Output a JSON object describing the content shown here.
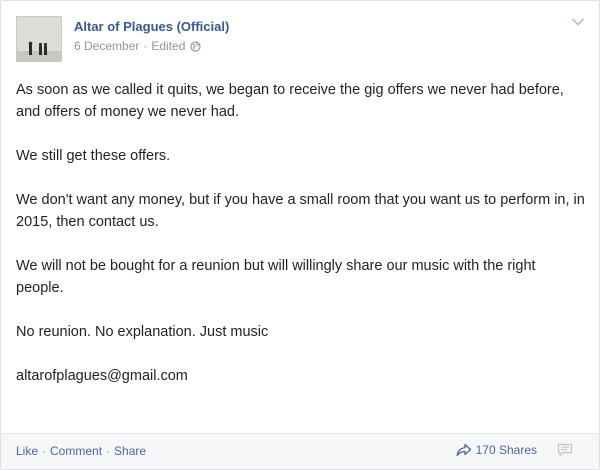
{
  "post": {
    "author": "Altar of Plagues (Official)",
    "date": "6 December",
    "edited": "Edited",
    "paragraphs": [
      "As soon as we called it quits, we began to receive the gig offers we never had before, and offers of money we never had.",
      "We still get these offers.",
      "We don't want any money, but if you have a small room that you want us to perform in, in 2015, then contact us.",
      "We will not be bought for a reunion but will willingly share our music with the right people.",
      "No reunion. No explanation. Just music",
      "altarofplagues@gmail.com"
    ]
  },
  "footer": {
    "like": "Like",
    "comment": "Comment",
    "share": "Share",
    "shares_count": "170 Shares"
  },
  "icons": {
    "audience": "globe-icon",
    "menu": "chevron-down-icon",
    "shares": "share-arrow-icon",
    "comments": "comment-bubble-icon"
  },
  "colors": {
    "link": "#365899",
    "text": "#1d2129",
    "muted": "#90949c",
    "background": "#ffffff"
  }
}
